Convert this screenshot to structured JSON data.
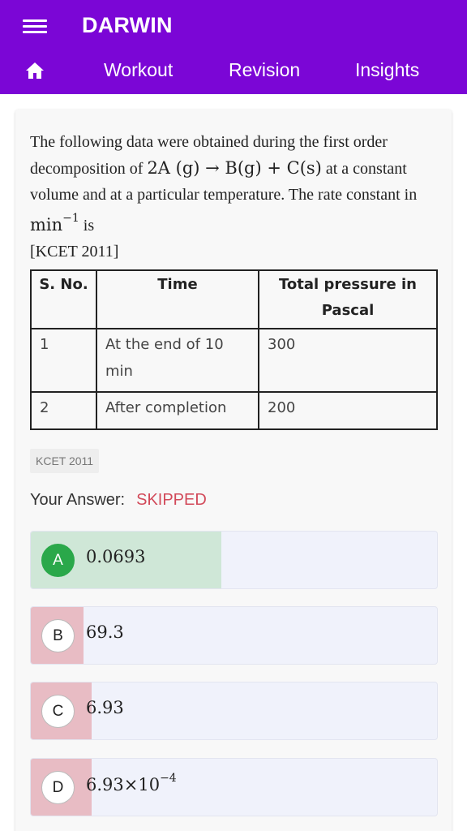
{
  "appbar": {
    "title": "DARWIN",
    "nav": [
      {
        "label": "Workout"
      },
      {
        "label": "Revision"
      },
      {
        "label": "Insights"
      }
    ],
    "color": "#7b06d6"
  },
  "question": {
    "text_1": "The following data were obtained during the first order decomposition of ",
    "equation": "2A (g) → B(g) + C(s)",
    "text_2": " at a constant volume and at a particular temperature. The rate constant in ",
    "unit_base": "min",
    "unit_exp": "−1",
    "text_3": " is",
    "source": "[KCET 2011]"
  },
  "table": {
    "headers": [
      "S. No.",
      "Time",
      "Total pressure in Pascal"
    ],
    "rows": [
      [
        "1",
        "At the end of 10 min",
        "300"
      ],
      [
        "2",
        "After completion",
        "200"
      ]
    ]
  },
  "tag": "KCET 2011",
  "answer": {
    "label": "Your Answer:",
    "value": "SKIPPED",
    "value_color": "#d24a5a"
  },
  "options": [
    {
      "letter": "A",
      "value": "0.0693",
      "exp": "",
      "fill_color": "#cfe7d7",
      "correct": true,
      "percent": 47
    },
    {
      "letter": "B",
      "value": "69.3",
      "exp": "",
      "fill_color": "#e8bcc4",
      "correct": false,
      "percent": 13
    },
    {
      "letter": "C",
      "value": "6.93",
      "exp": "",
      "fill_color": "#e8bcc4",
      "correct": false,
      "percent": 15
    },
    {
      "letter": "D",
      "value": "6.93×10",
      "exp": "−4",
      "fill_color": "#e8bcc4",
      "correct": false,
      "percent": 15
    }
  ]
}
